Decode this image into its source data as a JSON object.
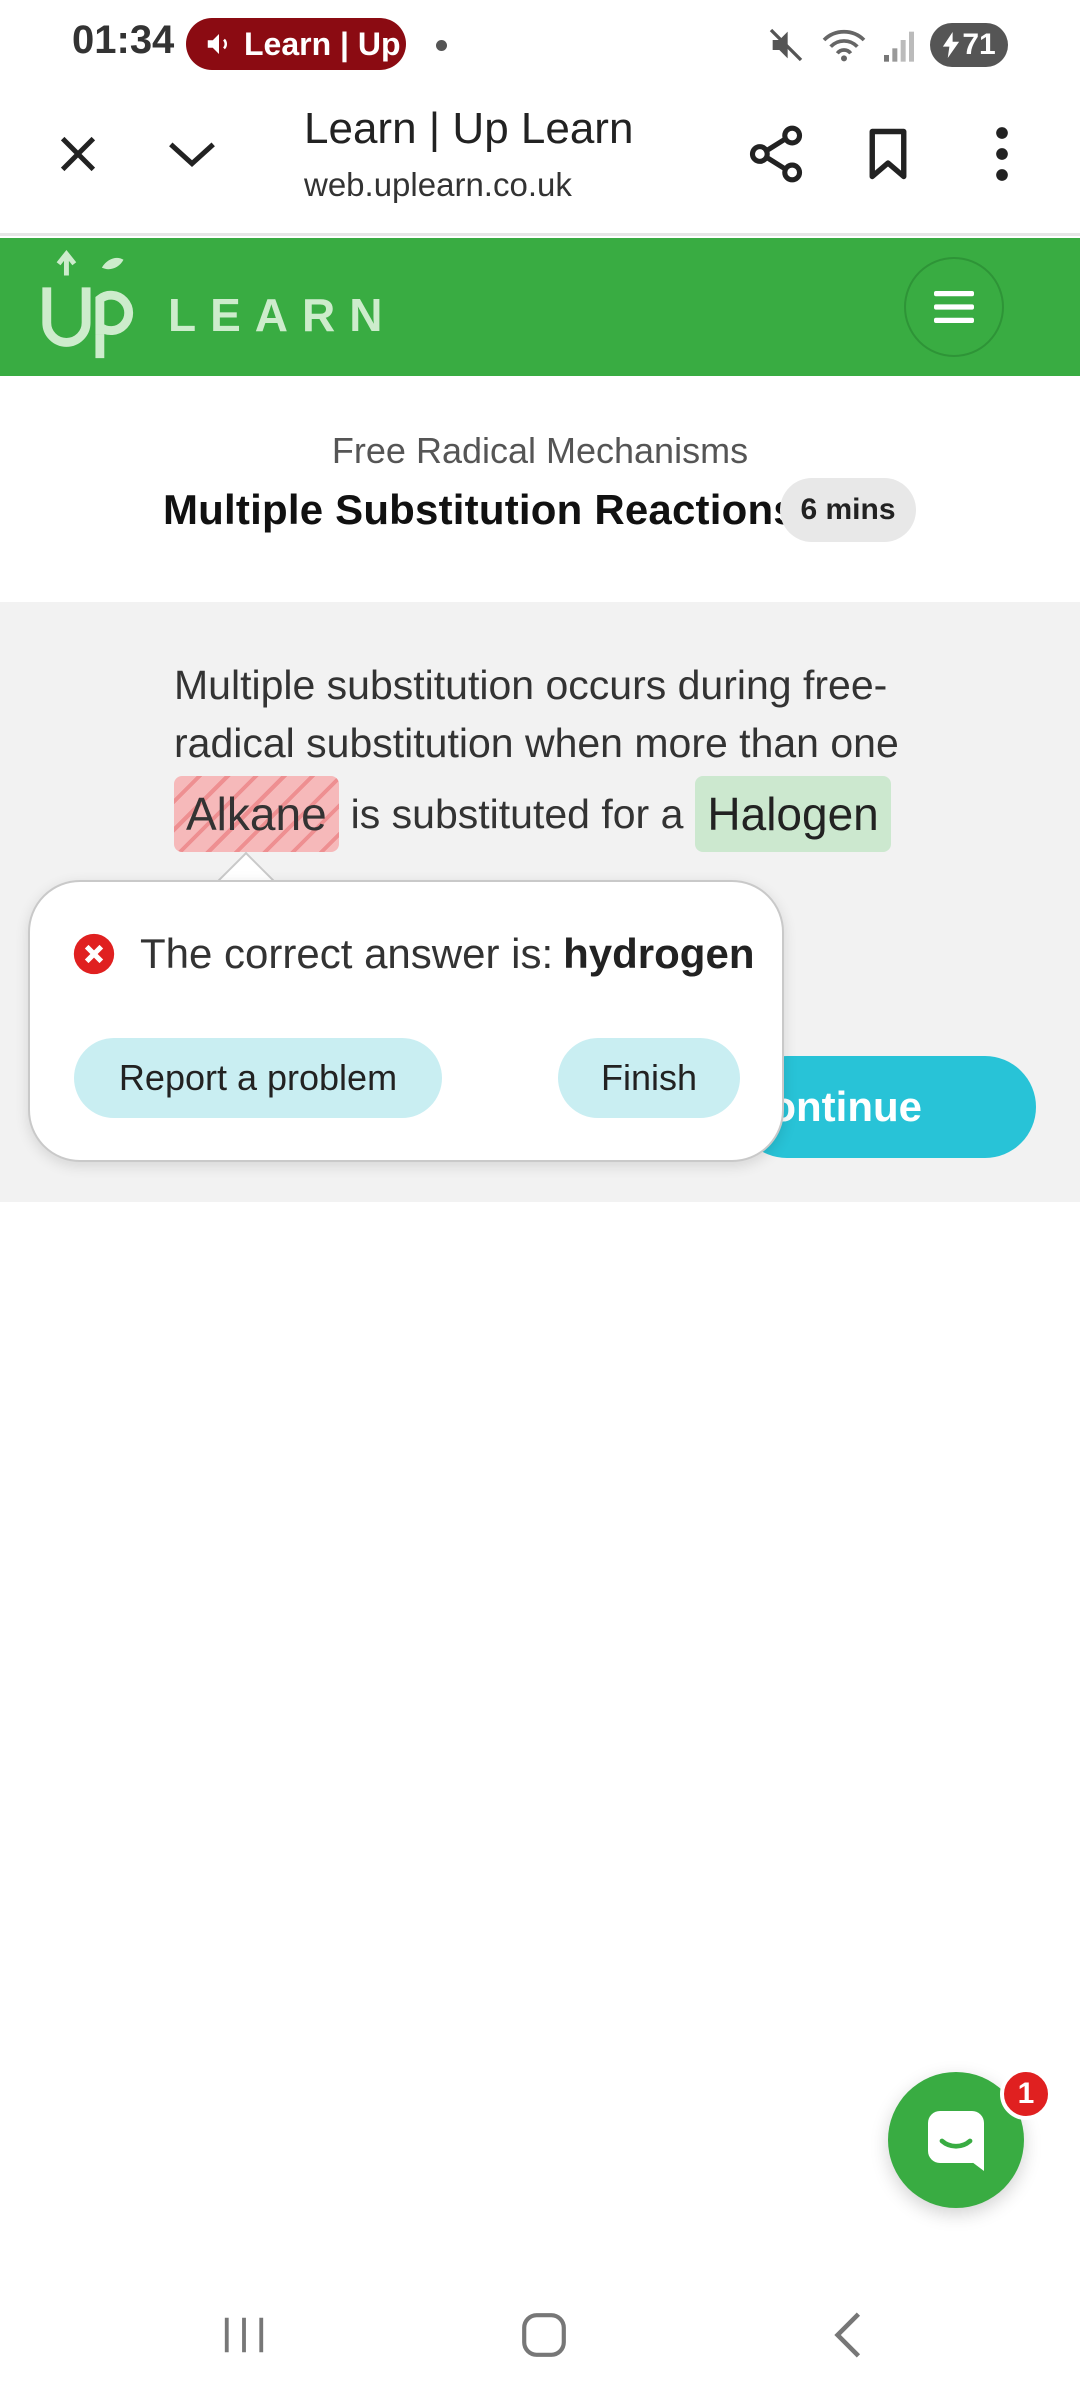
{
  "status_bar": {
    "time": "01:34",
    "media_pill_text": "Learn | Up",
    "battery": "71",
    "icons": [
      "mute-icon",
      "wifi-icon",
      "signal-icon",
      "battery-icon"
    ]
  },
  "browser": {
    "title": "Learn | Up Learn",
    "url": "web.uplearn.co.uk",
    "buttons": [
      "close-icon",
      "chevron-down-icon",
      "share-icon",
      "bookmark-icon",
      "more-vert-icon"
    ]
  },
  "site_header": {
    "logo_mark": "Up",
    "logo_text": "LEARN",
    "brand_color": "#39ac42"
  },
  "lesson": {
    "section": "Free Radical Mechanisms",
    "title": "Multiple Substitution Reactions",
    "duration": "6 mins"
  },
  "question": {
    "line1": "Multiple substitution occurs during free-",
    "line2": "radical substitution when more than one",
    "wrong_answer": "Alkane",
    "middle_text": "is substituted for a",
    "right_answer": "Halogen"
  },
  "continue_button": "ontinue",
  "feedback": {
    "label": "The correct answer is:",
    "answer": "hydrogen",
    "report_button": "Report a problem",
    "finish_button": "Finish",
    "error_color": "#e02020"
  },
  "chat": {
    "badge_count": "1"
  },
  "android_nav": [
    "recent-apps-icon",
    "home-icon",
    "back-icon"
  ]
}
